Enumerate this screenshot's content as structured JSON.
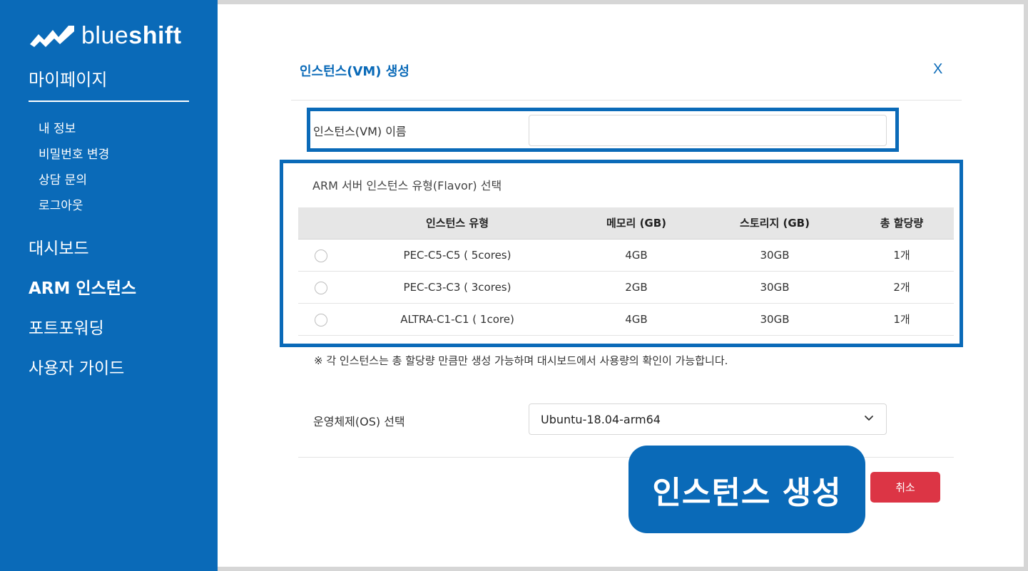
{
  "brand": {
    "name_light": "blue",
    "name_bold": "shift",
    "logo_icon": "wave-logo-icon"
  },
  "sidebar": {
    "title": "마이페이지",
    "sub_items": [
      "내 정보",
      "비밀번호 변경",
      "상담 문의",
      "로그아웃"
    ],
    "main_items": [
      "대시보드",
      "ARM 인스턴스",
      "포트포워딩",
      "사용자 가이드"
    ]
  },
  "modal": {
    "title": "인스턴스(VM) 생성",
    "close_label": "X",
    "name_label": "인스턴스(VM) 이름",
    "name_value": "",
    "flavor_title": "ARM 서버 인스턴스 유형(Flavor) 선택",
    "table": {
      "headers": [
        "인스턴스 유형",
        "메모리 (GB)",
        "스토리지 (GB)",
        "총 할당량"
      ],
      "rows": [
        [
          "PEC-C5-C5 ( 5cores)",
          "4GB",
          "30GB",
          "1개"
        ],
        [
          "PEC-C3-C3 ( 3cores)",
          "2GB",
          "30GB",
          "2개"
        ],
        [
          "ALTRA-C1-C1 ( 1core)",
          "4GB",
          "30GB",
          "1개"
        ]
      ]
    },
    "note": "※ 각 인스턴스는 총 할당량 만큼만 생성 가능하며 대시보드에서 사용량의 확인이 가능합니다.",
    "os_label": "운영체제(OS) 선택",
    "os_selected": "Ubuntu-18.04-arm64",
    "create_label": "인스턴스 생성",
    "cancel_label": "취소"
  },
  "colors": {
    "brand_blue": "#0a6ab8",
    "cancel_red": "#dc3545",
    "table_header_bg": "#e6e6e6"
  }
}
